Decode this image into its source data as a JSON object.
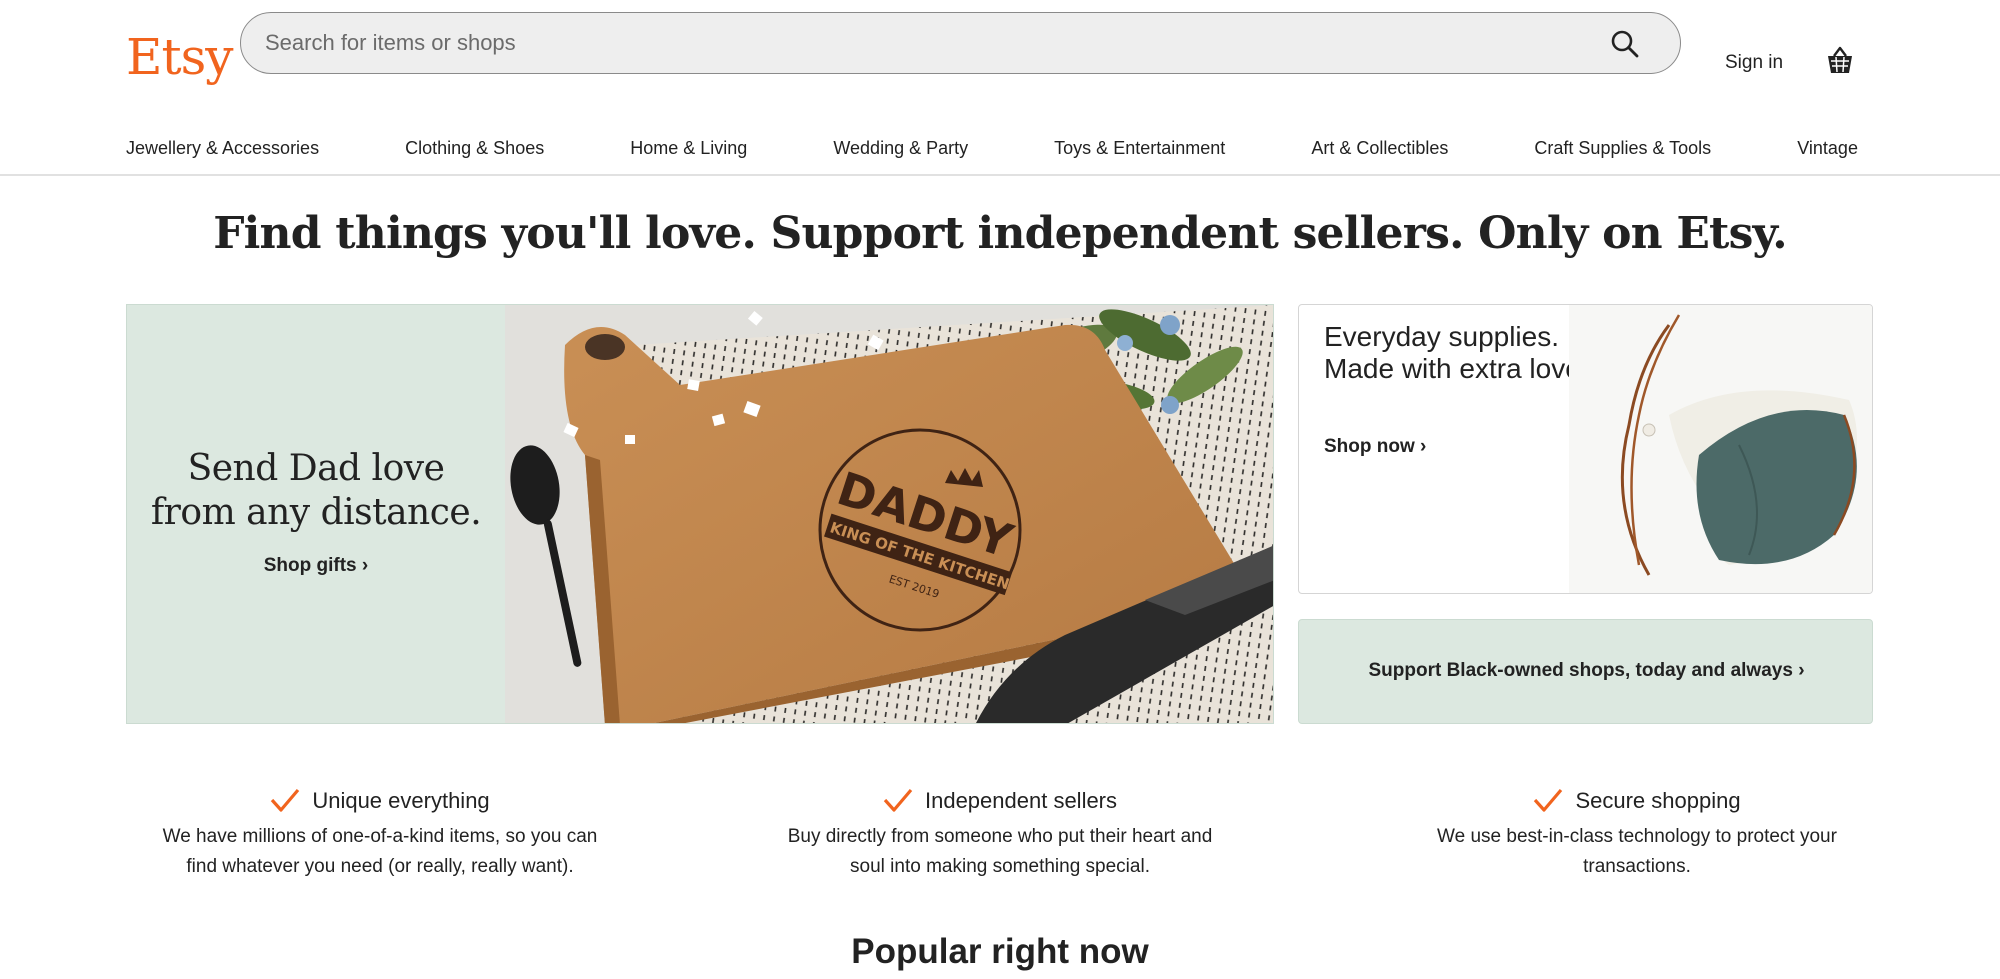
{
  "header": {
    "logo": "Etsy",
    "search_placeholder": "Search for items or shops",
    "sign_in": "Sign in"
  },
  "categories": [
    "Jewellery & Accessories",
    "Clothing & Shoes",
    "Home & Living",
    "Wedding & Party",
    "Toys & Entertainment",
    "Art & Collectibles",
    "Craft Supplies & Tools",
    "Vintage"
  ],
  "tagline": "Find things you'll love. Support independent sellers. Only on Etsy.",
  "hero": {
    "title": "Send Dad love from any distance.",
    "link": "Shop gifts",
    "board_text_main": "DADDY",
    "board_text_banner": "KING OF THE KITCHEN",
    "board_text_est": "EST 2019"
  },
  "promo_card": {
    "title": "Everyday supplies. Made with extra love.",
    "link": "Shop now"
  },
  "support_card": {
    "link": "Support Black-owned shops, today and always"
  },
  "value_props": [
    {
      "title": "Unique everything",
      "desc": "We have millions of one-of-a-kind items, so you can find whatever you need (or really, really want)."
    },
    {
      "title": "Independent sellers",
      "desc": "Buy directly from someone who put their heart and soul into making something special."
    },
    {
      "title": "Secure shopping",
      "desc": "We use best-in-class technology to protect your transactions."
    }
  ],
  "popular_heading": "Popular right now",
  "colors": {
    "brand": "#f1641e",
    "mint": "#dce8e0"
  }
}
